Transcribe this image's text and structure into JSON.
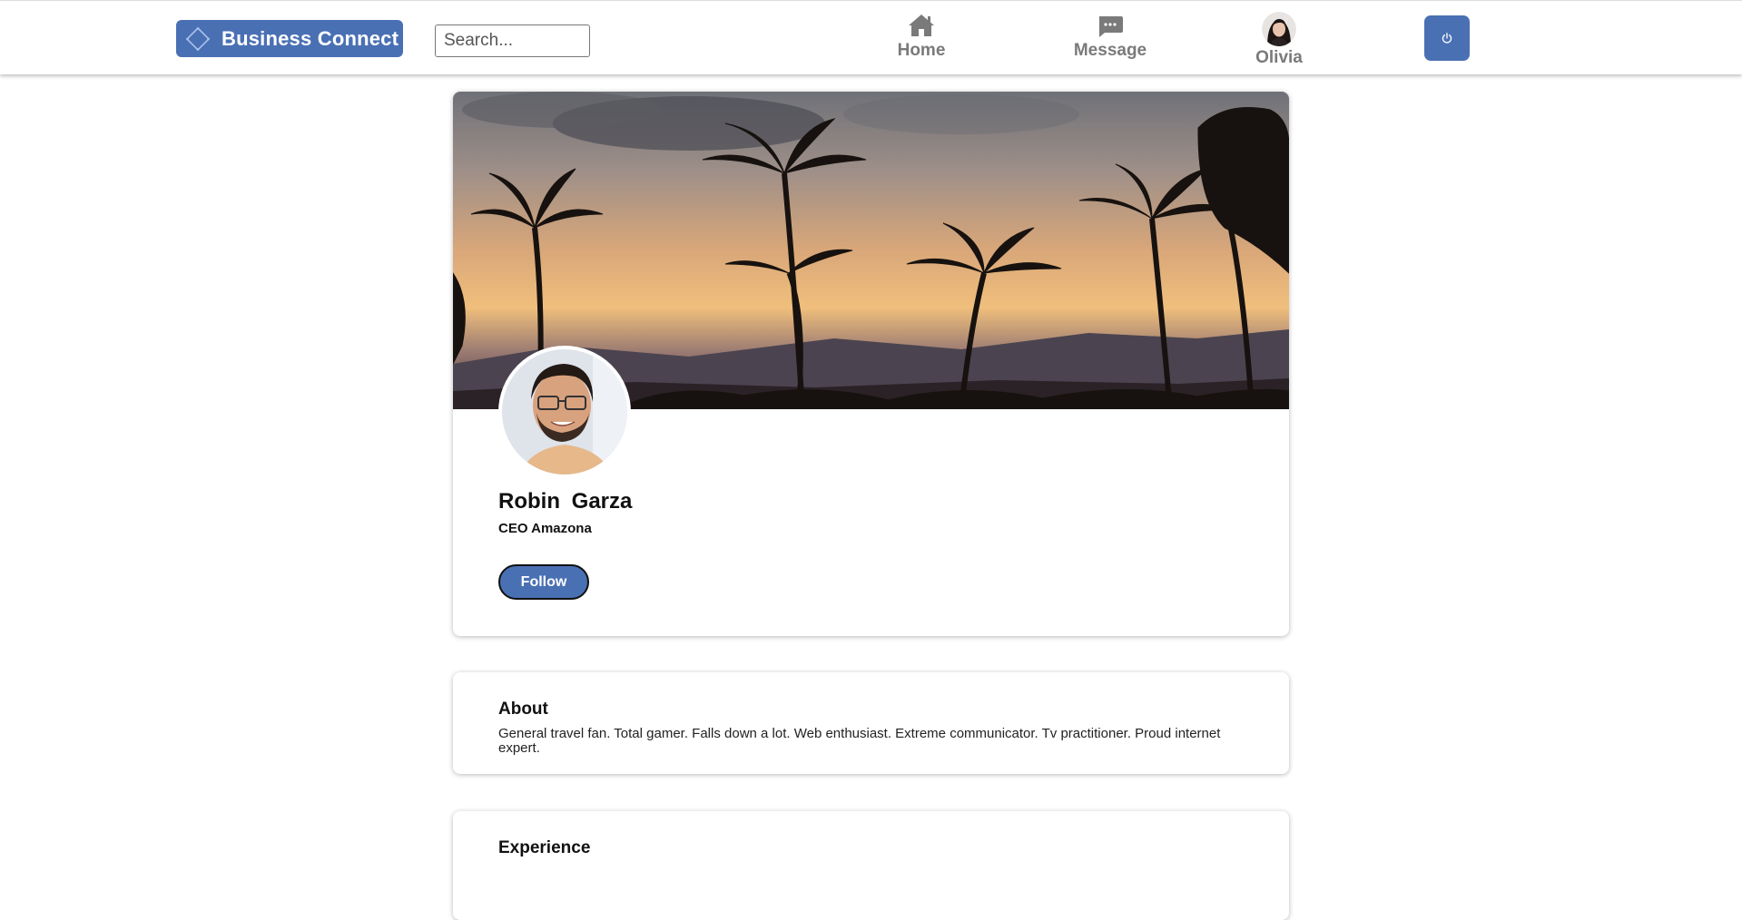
{
  "header": {
    "logo_text": "Business Connect",
    "search": {
      "placeholder": "Search...",
      "value": ""
    },
    "nav": {
      "home_label": "Home",
      "message_label": "Message",
      "user_label": "Olivia"
    },
    "icons": {
      "logo": "diamond-logo-icon",
      "home": "home-icon",
      "message": "chat-bubble-icon",
      "user": "avatar",
      "logout": "power-icon"
    }
  },
  "profile": {
    "first_name": "Robin",
    "last_name": "Garza",
    "full_name": "Robin  Garza",
    "title": "CEO Amazona",
    "follow_label": "Follow"
  },
  "about": {
    "heading": "About",
    "text": "General travel fan. Total gamer. Falls down a lot. Web enthusiast. Extreme communicator. Tv practitioner. Proud internet expert."
  },
  "experience": {
    "heading": "Experience"
  },
  "colors": {
    "accent": "#4a70b4",
    "nav_gray": "#7a7a7a",
    "text": "#111111"
  }
}
